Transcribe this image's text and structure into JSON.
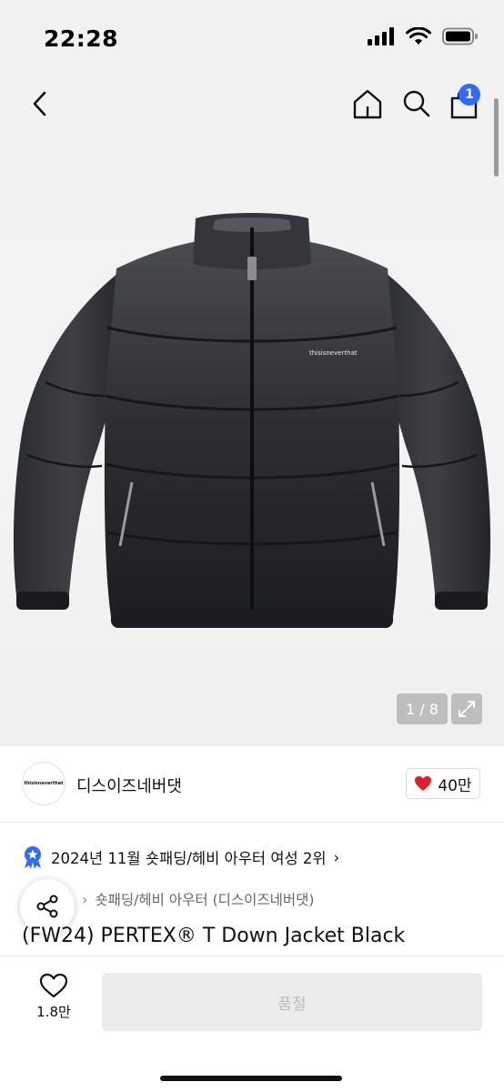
{
  "status_bar": {
    "time": "22:28"
  },
  "nav": {
    "cart_count": "1"
  },
  "gallery": {
    "counter": "1 / 8",
    "jacket_logo": "thisisneverthat"
  },
  "brand": {
    "logo_text": "thisisneverthat",
    "name": "디스이즈네버댓",
    "like_count": "40만"
  },
  "ranking": {
    "text": "2024년 11월 숏패딩/헤비 아우터 여성 2위",
    "chevron": "›"
  },
  "category": {
    "chevron": "›",
    "text": "숏패딩/헤비 아우터 (디스이즈네버댓)"
  },
  "product": {
    "title": "(FW24) PERTEX® T Down Jacket Black"
  },
  "bottom_bar": {
    "wish_count": "1.8만",
    "buy_label": "품절"
  },
  "colors": {
    "accent": "#2f6bff",
    "heart": "#e11d2c",
    "disabled_button": "#ececec"
  }
}
